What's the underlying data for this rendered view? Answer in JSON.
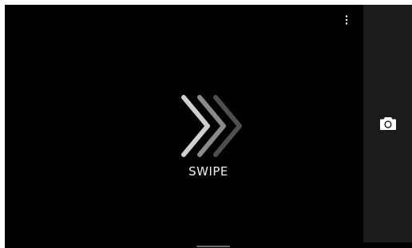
{
  "swipe_hint": {
    "label": "SWIPE"
  },
  "icons": {
    "overflow": "more-vert-icon",
    "camera": "camera-icon",
    "chevrons": "triple-chevron-right-icon"
  },
  "colors": {
    "background": "#000000",
    "side_panel": "#1b1b1b",
    "chevron_front": "#cfcfcf",
    "chevron_middle": "#8a8a8a",
    "chevron_back": "#4f4f4f",
    "icon": "#ffffff"
  }
}
